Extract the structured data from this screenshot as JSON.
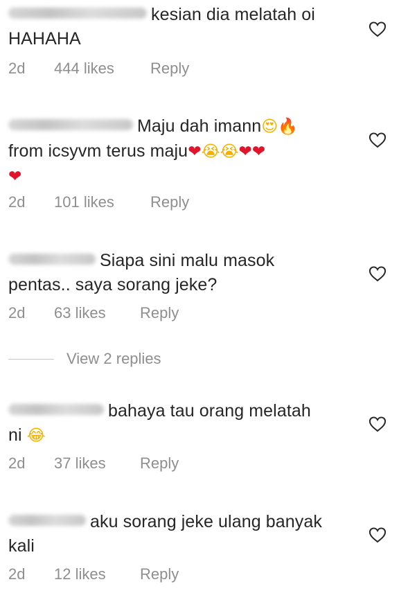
{
  "comments": [
    {
      "text_line1": "kesian dia melatah oi",
      "text_line2": "HAHAHA",
      "time": "2d",
      "likes": "444 likes",
      "reply": "Reply"
    },
    {
      "text_line1": "Maju dah imann",
      "text_line2": "from icsyvm terus maju",
      "time": "2d",
      "likes": "101 likes",
      "reply": "Reply"
    },
    {
      "text_line1": "Siapa sini malu masok",
      "text_line2": "pentas.. saya sorang jeke?",
      "time": "2d",
      "likes": "63 likes",
      "reply": "Reply"
    },
    {
      "text_line1": "bahaya tau orang melatah",
      "text_line2": "ni",
      "time": "2d",
      "likes": "37 likes",
      "reply": "Reply"
    },
    {
      "text_line1": "aku sorang jeke ulang banyak",
      "text_line2": "kali",
      "time": "2d",
      "likes": "12 likes",
      "reply": "Reply"
    }
  ],
  "view_replies": "View 2 replies",
  "emoji": {
    "heart_eyes": "😍",
    "fire": "🔥",
    "red_heart": "❤",
    "crying": "😭",
    "tears_of_joy": "😂"
  },
  "colors": {
    "text": "#262626",
    "meta": "#8e8e8e",
    "heart_red": "#e0142a"
  }
}
